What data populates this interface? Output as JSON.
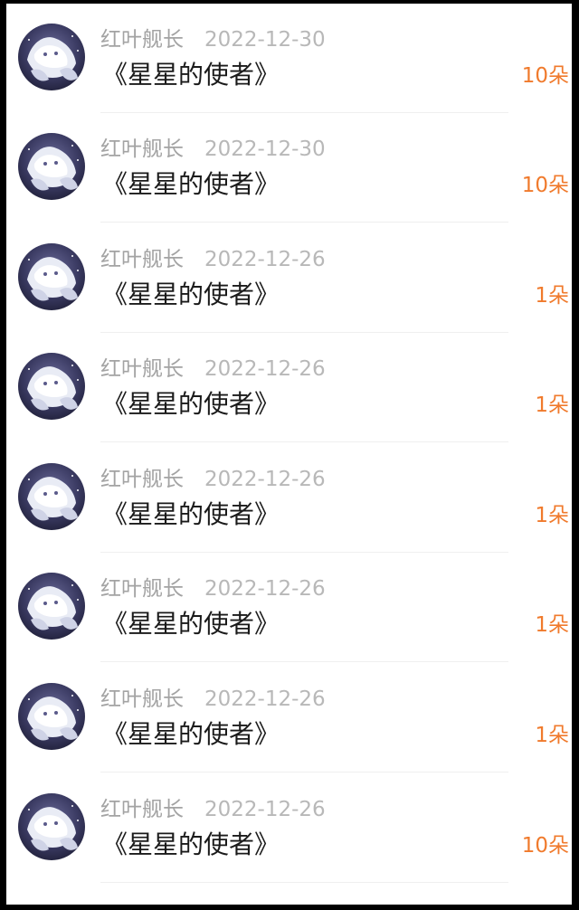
{
  "items": [
    {
      "name": "红叶舰长",
      "date": "2022-12-30",
      "title": "《星星的使者》",
      "amount": "10朵"
    },
    {
      "name": "红叶舰长",
      "date": "2022-12-30",
      "title": "《星星的使者》",
      "amount": "10朵"
    },
    {
      "name": "红叶舰长",
      "date": "2022-12-26",
      "title": "《星星的使者》",
      "amount": "1朵"
    },
    {
      "name": "红叶舰长",
      "date": "2022-12-26",
      "title": "《星星的使者》",
      "amount": "1朵"
    },
    {
      "name": "红叶舰长",
      "date": "2022-12-26",
      "title": "《星星的使者》",
      "amount": "1朵"
    },
    {
      "name": "红叶舰长",
      "date": "2022-12-26",
      "title": "《星星的使者》",
      "amount": "1朵"
    },
    {
      "name": "红叶舰长",
      "date": "2022-12-26",
      "title": "《星星的使者》",
      "amount": "1朵"
    },
    {
      "name": "红叶舰长",
      "date": "2022-12-26",
      "title": "《星星的使者》",
      "amount": "10朵"
    }
  ],
  "colors": {
    "name": "#a3a3a3",
    "date": "#b8b8b8",
    "title": "#1a1a1a",
    "amount": "#f07a2c",
    "avatar_bg": "#2a2a4a"
  },
  "icons": {
    "avatar": "white-fox-avatar-icon"
  }
}
